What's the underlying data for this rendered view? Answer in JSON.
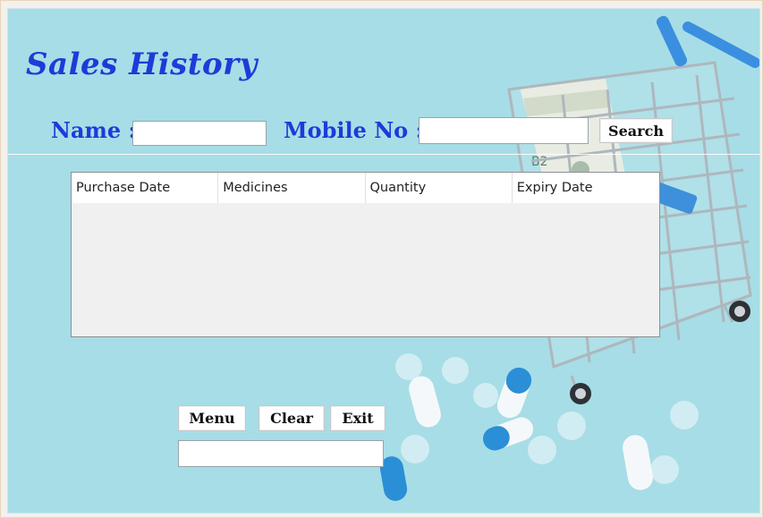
{
  "window": {
    "title": "Sales History"
  },
  "search": {
    "name_label": "Name :",
    "name_value": "",
    "mobile_label": "Mobile No :",
    "mobile_value": "",
    "search_label": "Search"
  },
  "table": {
    "columns": [
      "Purchase Date",
      "Medicines",
      "Quantity",
      "Expiry Date"
    ],
    "rows": []
  },
  "actions": {
    "menu_label": "Menu",
    "clear_label": "Clear",
    "exit_label": "Exit",
    "status_value": ""
  },
  "colors": {
    "accent": "#1d3bd8",
    "background": "#a7dde6"
  },
  "icons": [
    "shopping-cart-icon",
    "pill-icon"
  ]
}
